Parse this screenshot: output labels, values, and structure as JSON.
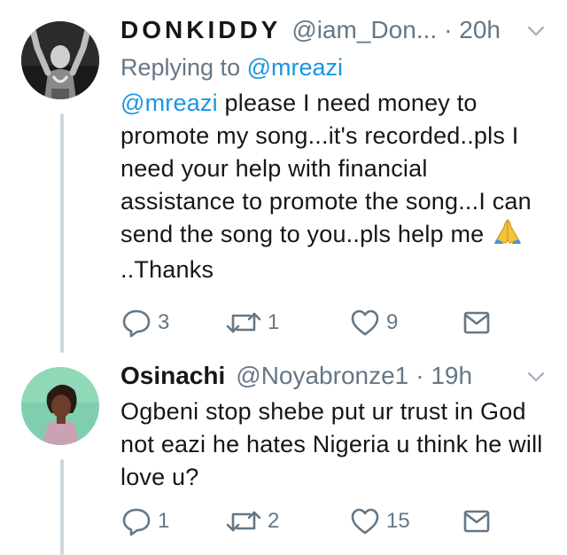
{
  "tweets": [
    {
      "name": "DONKIDDY",
      "handle": "@iam_Don...",
      "time": "· 20h",
      "replying_label": "Replying to",
      "replying_to": "@mreazi",
      "mention": "@mreazi",
      "text": " please I need money to promote my song...it's recorded..pls I need your help with financial assistance to promote the song...I can send the song to you..pls help me",
      "text_end": "..Thanks",
      "emoji": "folded-hands-emoji",
      "replies": "3",
      "retweets": "1",
      "likes": "9"
    },
    {
      "name": "Osinachi",
      "handle": "@Noyabronze1",
      "time": "· 19h",
      "text": "Ogbeni stop shebe put ur trust in God not eazi he hates Nigeria u think he will love u?",
      "replies": "1",
      "retweets": "2",
      "likes": "15"
    }
  ],
  "colors": {
    "link": "#1b95e0",
    "secondary": "#657786",
    "thread_line": "#ccd6dd"
  },
  "icons": [
    "chevron-down-icon",
    "reply-icon",
    "retweet-icon",
    "like-icon",
    "direct-message-icon"
  ]
}
